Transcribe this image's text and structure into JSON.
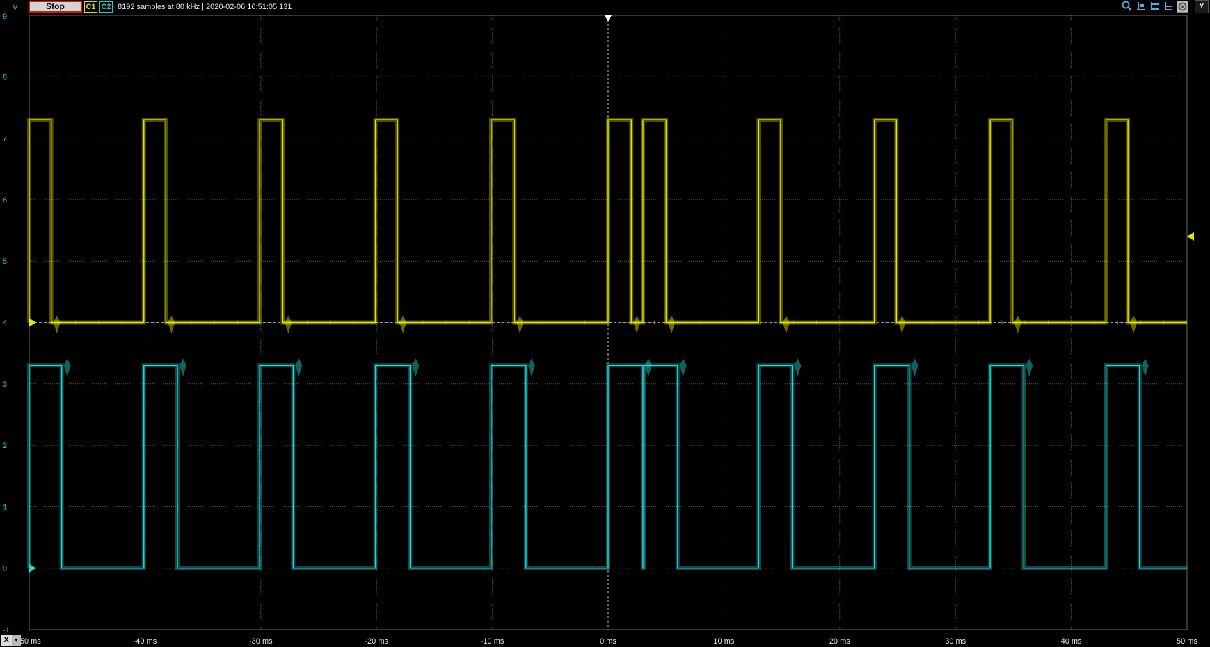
{
  "toolbar": {
    "stop_label": "Stop",
    "channel1_label": "C1",
    "channel2_label": "C2",
    "status_text": "8192 samples at 80 kHz | 2020-02-06 16:51:05.131",
    "y_label": "Y",
    "x_label": "X",
    "x_dropdown": "▾",
    "tools": [
      {
        "icon": "zoom-icon",
        "glyph": "🔍"
      },
      {
        "icon": "cursor-measure-icon",
        "glyph": "⊥"
      },
      {
        "icon": "horizontal-cursor-icon",
        "glyph": "⊏"
      },
      {
        "icon": "vertical-cursor-icon",
        "glyph": "⊏"
      },
      {
        "icon": "autoscale-icon",
        "glyph": "⟲"
      }
    ]
  },
  "colors": {
    "channel1": "#e6e600",
    "channel2": "#2ad4d4",
    "grid": "#5a5a5a",
    "axis_text": "#20d0d0",
    "x_text": "#e6e6e6"
  },
  "chart_data": {
    "type": "line",
    "y_unit_label": "V",
    "xlim": [
      -50,
      50
    ],
    "ylim": [
      -1,
      9
    ],
    "x_ticks": [
      -50,
      -40,
      -30,
      -20,
      -10,
      0,
      10,
      20,
      30,
      40,
      50
    ],
    "x_tick_labels": [
      "-50 ms",
      "-40 ms",
      "-30 ms",
      "-20 ms",
      "-10 ms",
      "0 ms",
      "10 ms",
      "20 ms",
      "30 ms",
      "40 ms",
      "50 ms"
    ],
    "y_ticks": [
      -1,
      0,
      1,
      2,
      3,
      4,
      5,
      6,
      7,
      8,
      9
    ],
    "y_tick_labels": [
      "-1",
      "0",
      "1",
      "2",
      "3",
      "4",
      "5",
      "6",
      "7",
      "8",
      "9"
    ],
    "trigger_time_ms": 0,
    "trigger_level_v": 5.4,
    "grid": true,
    "series": [
      {
        "name": "C1",
        "low_v": 4.0,
        "high_v": 7.3,
        "offset_v": 4.0,
        "pulses_ms": [
          [
            -50,
            -48.1
          ],
          [
            -40.1,
            -38.2
          ],
          [
            -30.1,
            -28.1
          ],
          [
            -20.1,
            -18.2
          ],
          [
            -10.1,
            -8.1
          ],
          [
            0,
            2.0
          ],
          [
            3.0,
            5.0
          ],
          [
            13.0,
            14.9
          ],
          [
            23.0,
            24.9
          ],
          [
            33.0,
            34.9
          ],
          [
            43.0,
            44.9
          ]
        ]
      },
      {
        "name": "C2",
        "low_v": 0.0,
        "high_v": 3.3,
        "offset_v": 0.0,
        "pulses_ms": [
          [
            -50,
            -47.2
          ],
          [
            -40.1,
            -37.2
          ],
          [
            -30.1,
            -27.2
          ],
          [
            -20.1,
            -17.1
          ],
          [
            -10.1,
            -7.1
          ],
          [
            0,
            3.0
          ],
          [
            3.1,
            6.0
          ],
          [
            13.0,
            15.9
          ],
          [
            23.0,
            26.0
          ],
          [
            33.0,
            35.9
          ],
          [
            43.0,
            45.9
          ]
        ]
      }
    ]
  }
}
